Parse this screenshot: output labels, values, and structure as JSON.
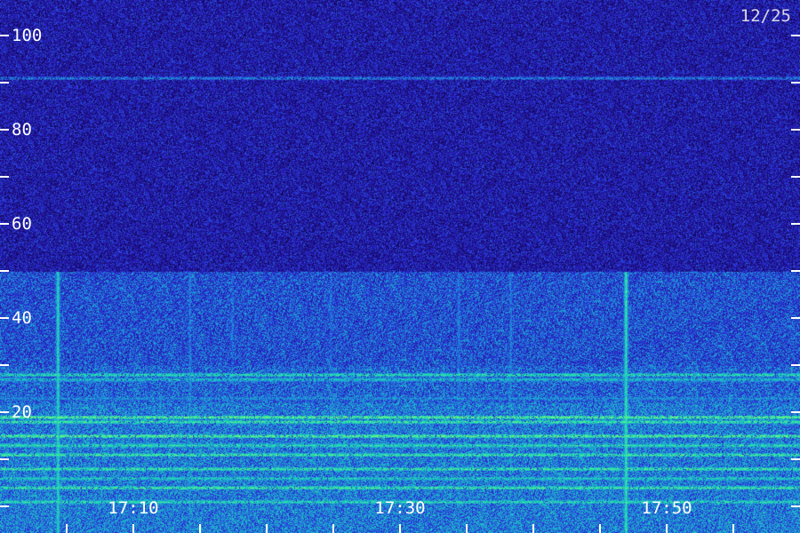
{
  "chart_data": {
    "type": "heatmap",
    "title": "",
    "xlabel": "",
    "ylabel": "",
    "date_label": "12/25",
    "y_axis": {
      "range": [
        0,
        100
      ],
      "ticks": [
        0,
        10,
        20,
        30,
        40,
        50,
        60,
        70,
        80,
        90,
        100
      ],
      "labels": [
        {
          "value": 20,
          "text": "20"
        },
        {
          "value": 40,
          "text": "40"
        },
        {
          "value": 60,
          "text": "60"
        },
        {
          "value": 80,
          "text": "80"
        },
        {
          "value": 100,
          "text": "100"
        }
      ]
    },
    "x_axis": {
      "labels": [
        "17:10",
        "17:30",
        "17:50"
      ],
      "minor_ticks_per_label": 4
    },
    "colormap": [
      "#05021e",
      "#1c0a7a",
      "#2a2ad6",
      "#1e9ad8",
      "#20e0b0",
      "#9cff60"
    ],
    "features": {
      "noise_floor_level": 0.3,
      "enhanced_band_upper_value": 50,
      "enhanced_band_level": 0.46,
      "horizontal_lines": [
        {
          "value": 91,
          "level": 0.6
        },
        {
          "value": 28,
          "level": 0.85
        },
        {
          "value": 27,
          "level": 0.75
        },
        {
          "value": 23,
          "level": 0.6
        },
        {
          "value": 19,
          "level": 0.95
        },
        {
          "value": 18,
          "level": 0.9
        },
        {
          "value": 15,
          "level": 0.95
        },
        {
          "value": 13,
          "level": 0.85
        },
        {
          "value": 11,
          "level": 0.9
        },
        {
          "value": 8,
          "level": 0.9
        },
        {
          "value": 6,
          "level": 0.8
        },
        {
          "value": 4,
          "level": 0.9
        },
        {
          "value": 1,
          "level": 0.85
        }
      ],
      "vertical_streaks": [
        {
          "x_fraction": 0.072,
          "level": 0.8
        },
        {
          "x_fraction": 0.237,
          "level": 0.55
        },
        {
          "x_fraction": 0.29,
          "level": 0.5
        },
        {
          "x_fraction": 0.413,
          "level": 0.5
        },
        {
          "x_fraction": 0.573,
          "level": 0.55
        },
        {
          "x_fraction": 0.638,
          "level": 0.55
        },
        {
          "x_fraction": 0.782,
          "level": 0.85
        }
      ]
    }
  }
}
